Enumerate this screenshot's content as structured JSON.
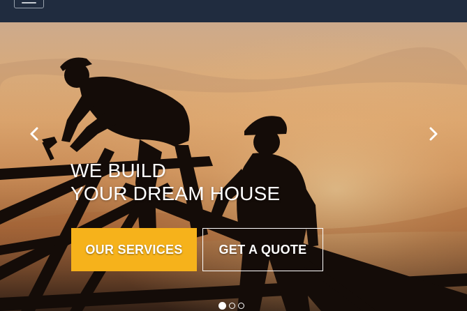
{
  "navbar": {
    "menu_icon": "hamburger-icon"
  },
  "hero": {
    "headline_line1": "WE BUILD",
    "headline_line2": "YOUR DREAM HOUSE",
    "primary_button_label": "OUR SERVICES",
    "secondary_button_label": "GET A QUOTE",
    "prev_icon": "chevron-left-icon",
    "next_icon": "chevron-right-icon",
    "slide_count": 3,
    "active_slide": 1
  },
  "colors": {
    "navbar_bg": "#202c3f",
    "accent": "#f6b21b",
    "text": "#ffffff"
  }
}
